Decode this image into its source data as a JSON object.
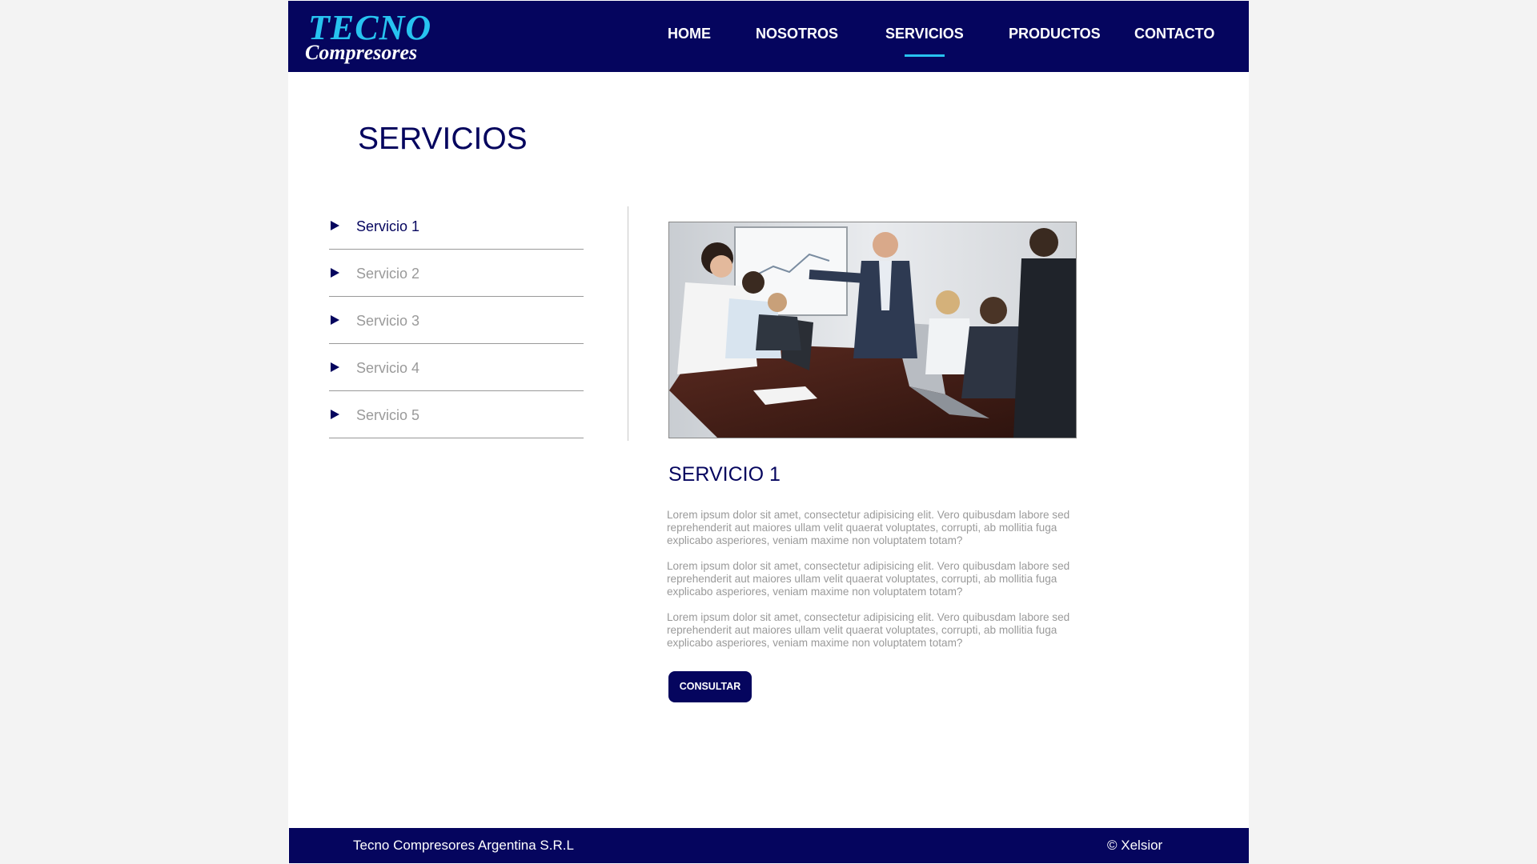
{
  "brand": {
    "logo_top": "TECNO",
    "logo_bottom": "Compresores",
    "colors": {
      "navy": "#05055e",
      "accent": "#27c3f0",
      "muted_text": "#9a9a9a"
    }
  },
  "nav": {
    "items": [
      {
        "label": "HOME",
        "active": false
      },
      {
        "label": "NOSOTROS",
        "active": false
      },
      {
        "label": "SERVICIOS",
        "active": true
      },
      {
        "label": "PRODUCTOS",
        "active": false
      },
      {
        "label": "CONTACTO",
        "active": false
      }
    ]
  },
  "page": {
    "title": "SERVICIOS"
  },
  "sidebar": {
    "items": [
      {
        "label": "Servicio 1",
        "active": true,
        "icon": "triangle-right-icon"
      },
      {
        "label": "Servicio 2",
        "active": false,
        "icon": "triangle-right-icon"
      },
      {
        "label": "Servicio 3",
        "active": false,
        "icon": "triangle-right-icon"
      },
      {
        "label": "Servicio 4",
        "active": false,
        "icon": "triangle-right-icon"
      },
      {
        "label": "Servicio 5",
        "active": false,
        "icon": "triangle-right-icon"
      }
    ]
  },
  "detail": {
    "heading": "SERVICIO 1",
    "paragraphs": [
      "Lorem ipsum dolor sit amet, consectetur adipisicing elit. Vero quibusdam labore sed reprehenderit aut maiores ullam velit quaerat voluptates, corrupti, ab mollitia fuga explicabo asperiores, veniam maxime non voluptatem totam?",
      "Lorem ipsum dolor sit amet, consectetur adipisicing elit. Vero quibusdam labore sed reprehenderit aut maiores ullam velit quaerat voluptates, corrupti, ab mollitia fuga explicabo asperiores, veniam maxime non voluptatem totam?",
      "Lorem ipsum dolor sit amet, consectetur adipisicing elit. Vero quibusdam labore sed reprehenderit aut maiores ullam velit quaerat voluptates, corrupti, ab mollitia fuga explicabo asperiores, veniam maxime non voluptatem totam?"
    ],
    "button_label": "CONSULTAR"
  },
  "footer": {
    "company": "Tecno Compresores Argentina S.R.L",
    "credit": "© Xelsior"
  }
}
